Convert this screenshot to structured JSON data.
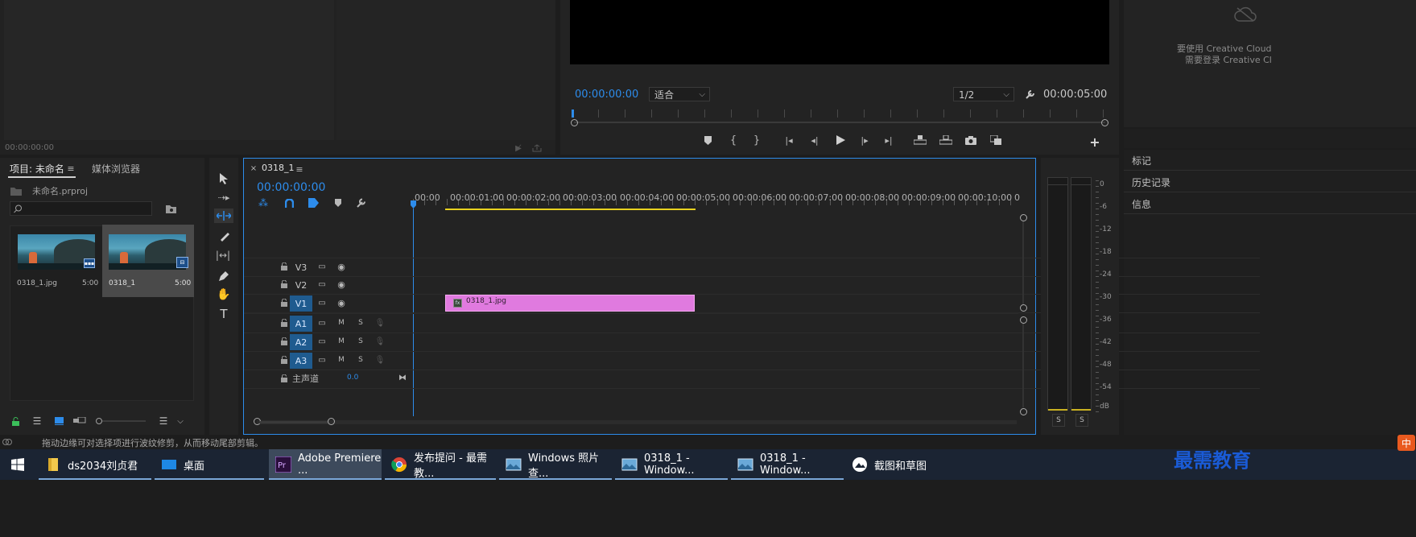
{
  "source_monitor": {
    "timecode": "00:00:00:00"
  },
  "program_monitor": {
    "timecode": "00:00:00:00",
    "fit_value": "适合",
    "resolution_value": "1/2",
    "duration": "00:00:05:00"
  },
  "cc_panel": {
    "line1": "要使用 Creative Cloud",
    "line2": "需要登录 Creative Cl"
  },
  "right_panels": [
    {
      "label": "标记"
    },
    {
      "label": "历史记录"
    },
    {
      "label": "信息"
    }
  ],
  "project": {
    "tab_active": "项目: 未命名",
    "tab_media": "媒体浏览器",
    "file_name": "未命名.prproj",
    "search_placeholder": "",
    "items": [
      {
        "name": "0318_1.jpg",
        "duration": "5:00"
      },
      {
        "name": "0318_1",
        "duration": "5:00"
      }
    ]
  },
  "timeline": {
    "tab": "0318_1",
    "timecode": "00:00:00:00",
    "ruler": [
      "00:00",
      "00:00:01:00",
      "00:00:02:00",
      "00:00:03:00",
      "00:00:04:00",
      "00:00:05:00",
      "00:00:06:00",
      "00:00:07:00",
      "00:00:08:00",
      "00:00:09:00",
      "00:00:10:00",
      "0"
    ],
    "video_tracks": [
      {
        "label": "V3"
      },
      {
        "label": "V2"
      },
      {
        "label": "V1",
        "targeted": true
      }
    ],
    "audio_tracks": [
      {
        "label": "A1"
      },
      {
        "label": "A2"
      },
      {
        "label": "A3"
      }
    ],
    "mute_label": "M",
    "solo_label": "S",
    "master": {
      "label": "主声道",
      "value": "0.0"
    },
    "clip": {
      "name": "0318_1.jpg",
      "color": "#e07adf"
    }
  },
  "audio_meter": {
    "scale": [
      "0",
      "-6",
      "-12",
      "-18",
      "-24",
      "-30",
      "-36",
      "-42",
      "-48",
      "-54",
      "dB"
    ],
    "solo_buttons": [
      "S",
      "S"
    ]
  },
  "status_bar": {
    "text": "拖动边缘可对选择项进行波纹修剪，从而移动尾部剪辑。"
  },
  "taskbar": {
    "items": [
      {
        "label": "ds2034刘贞君",
        "icon": "folder-icon"
      },
      {
        "label": "桌面",
        "icon": "desktop-icon"
      },
      {
        "label": "Adobe Premiere ...",
        "icon": "premiere-icon"
      },
      {
        "label": "发布提问 - 最需教...",
        "icon": "chrome-icon"
      },
      {
        "label": "Windows 照片查...",
        "icon": "photos-icon"
      },
      {
        "label": "0318_1 - Window...",
        "icon": "photos-icon"
      },
      {
        "label": "0318_1 - Window...",
        "icon": "photos-icon"
      },
      {
        "label": "截图和草图",
        "icon": "snip-icon"
      }
    ],
    "watermark": "最需教育",
    "ime": "中"
  },
  "colors": {
    "accent": "#2d8ceb",
    "clip": "#e07adf",
    "track_target": "#1f5b8f",
    "work_area": "#e8d21f"
  }
}
